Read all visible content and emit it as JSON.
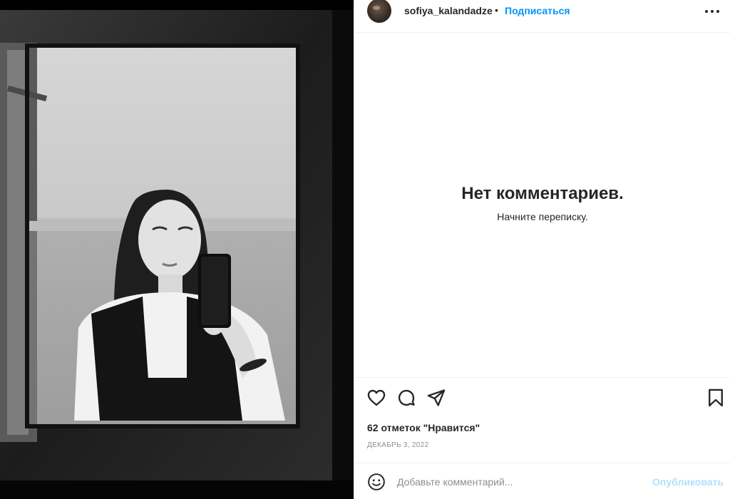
{
  "post": {
    "image_alt": "",
    "author": {
      "username": "sofiya_kalandadze",
      "separator": "•",
      "follow_label": "Подписаться",
      "avatar_icon": "profile-avatar"
    },
    "more_icon": "more-horizontal-icon"
  },
  "comments": {
    "empty_title": "Нет комментариев.",
    "empty_subtitle": "Начните переписку."
  },
  "actions": {
    "icons": [
      "heart-icon",
      "comment-icon",
      "share-icon",
      "bookmark-icon"
    ],
    "likes_text": "62 отметок \"Нравится\"",
    "date_text": "ДЕКАБРЬ 3, 2022"
  },
  "comment_form": {
    "emoji_icon": "emoji-icon",
    "placeholder": "Добавьте комментарий...",
    "value": "",
    "submit_label": "Опубликовать"
  },
  "colors": {
    "accent": "#0095f6",
    "accent_disabled": "#b2dffc",
    "text": "#262626",
    "muted": "#8e8e8e",
    "border": "#efefef"
  }
}
